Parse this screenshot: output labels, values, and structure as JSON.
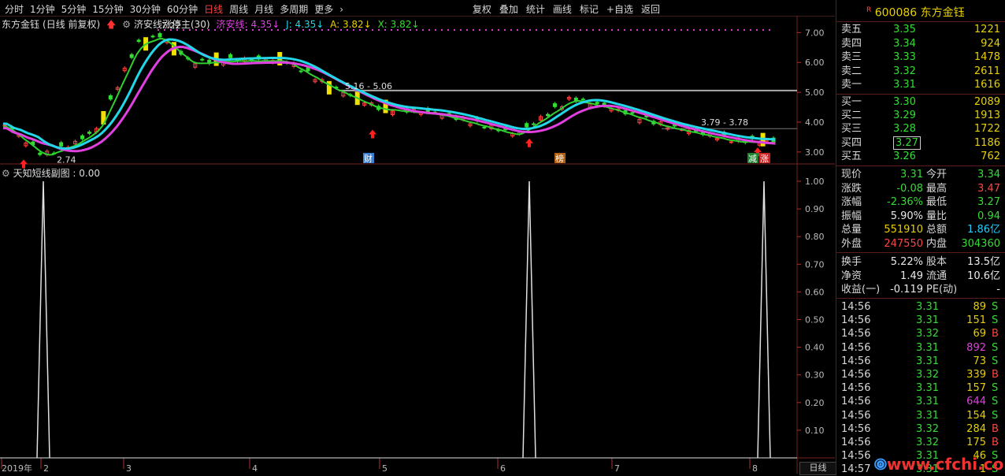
{
  "periods": [
    {
      "label": "分时"
    },
    {
      "label": "1分钟"
    },
    {
      "label": "5分钟"
    },
    {
      "label": "15分钟"
    },
    {
      "label": "30分钟"
    },
    {
      "label": "60分钟"
    },
    {
      "label": "日线",
      "active": true
    },
    {
      "label": "周线"
    },
    {
      "label": "月线"
    },
    {
      "label": "多周期"
    },
    {
      "label": "更多"
    }
  ],
  "tools": [
    "复权",
    "叠加",
    "统计",
    "画线",
    "标记",
    "+自选",
    "返回"
  ],
  "title": {
    "stock": "东方金钰",
    "mode": "(日线 前复权)",
    "indicator": "济安线涨停主(30)",
    "line_label": "济安线:",
    "line_value": "4.35↓",
    "j": "J: 4.35↓",
    "a": "A: 3.82↓",
    "x": "X: 3.82↓"
  },
  "sub_title": "天知短线副图 : 0.00",
  "annotations": {
    "high": "7.22",
    "low": "2.74",
    "band1": "5.16 - 5.06",
    "band2": "3.79 - 3.78",
    "marks": [
      {
        "text": "财",
        "color": "#3a7fd0"
      },
      {
        "text": "榜",
        "color": "#b06010"
      },
      {
        "text": "减",
        "color": "#208030"
      },
      {
        "text": "涨",
        "color": "#d02020"
      }
    ]
  },
  "price_axis": [
    "7.00",
    "6.00",
    "5.00",
    "4.00",
    "3.00"
  ],
  "sub_axis": [
    "1.00",
    "0.90",
    "0.80",
    "0.70",
    "0.60",
    "0.50",
    "0.40",
    "0.30",
    "0.20",
    "0.10"
  ],
  "x_axis": [
    "2019年",
    "2",
    "3",
    "4",
    "5",
    "6",
    "7",
    "8"
  ],
  "bottom_tab": "日线",
  "quote": {
    "code_badge": "R",
    "code": "600086",
    "name": "东方金钰",
    "asks": [
      {
        "label": "卖五",
        "price": "3.35",
        "vol": "1221"
      },
      {
        "label": "卖四",
        "price": "3.34",
        "vol": "924"
      },
      {
        "label": "卖三",
        "price": "3.33",
        "vol": "1478"
      },
      {
        "label": "卖二",
        "price": "3.32",
        "vol": "2611"
      },
      {
        "label": "卖一",
        "price": "3.31",
        "vol": "1616"
      }
    ],
    "bids": [
      {
        "label": "买一",
        "price": "3.30",
        "vol": "2089"
      },
      {
        "label": "买二",
        "price": "3.29",
        "vol": "1913"
      },
      {
        "label": "买三",
        "price": "3.28",
        "vol": "1722"
      },
      {
        "label": "买四",
        "price": "3.27",
        "vol": "1186"
      },
      {
        "label": "买五",
        "price": "3.26",
        "vol": "762"
      }
    ],
    "stats": [
      {
        "l1": "现价",
        "v1": "3.31",
        "c1": "green",
        "l2": "今开",
        "v2": "3.34",
        "c2": "green"
      },
      {
        "l1": "涨跌",
        "v1": "-0.08",
        "c1": "green",
        "l2": "最高",
        "v2": "3.47",
        "c2": "red"
      },
      {
        "l1": "涨幅",
        "v1": "-2.36%",
        "c1": "green",
        "l2": "最低",
        "v2": "3.27",
        "c2": "green"
      },
      {
        "l1": "振幅",
        "v1": "5.90%",
        "c1": "white",
        "l2": "量比",
        "v2": "0.94",
        "c2": "green"
      },
      {
        "l1": "总量",
        "v1": "551910",
        "c1": "yellow",
        "l2": "总额",
        "v2": "1.86亿",
        "c2": "cyan"
      },
      {
        "l1": "外盘",
        "v1": "247550",
        "c1": "red",
        "l2": "内盘",
        "v2": "304360",
        "c2": "green"
      }
    ],
    "stats2": [
      {
        "l1": "换手",
        "v1": "5.22%",
        "c1": "white",
        "l2": "股本",
        "v2": "13.5亿",
        "c2": "white"
      },
      {
        "l1": "净资",
        "v1": "1.49",
        "c1": "white",
        "l2": "流通",
        "v2": "10.6亿",
        "c2": "white"
      },
      {
        "l1": "收益(一)",
        "v1": "-0.119",
        "c1": "white",
        "l2": "PE(动)",
        "v2": "-",
        "c2": "white"
      }
    ],
    "ticks": [
      {
        "t": "14:56",
        "p": "3.31",
        "pc": "green",
        "v": "89",
        "vc": "yellow",
        "s": "S"
      },
      {
        "t": "14:56",
        "p": "3.31",
        "pc": "green",
        "v": "151",
        "vc": "yellow",
        "s": "S"
      },
      {
        "t": "14:56",
        "p": "3.32",
        "pc": "green",
        "v": "69",
        "vc": "yellow",
        "s": "B"
      },
      {
        "t": "14:56",
        "p": "3.31",
        "pc": "green",
        "v": "892",
        "vc": "magenta",
        "s": "S"
      },
      {
        "t": "14:56",
        "p": "3.31",
        "pc": "green",
        "v": "73",
        "vc": "yellow",
        "s": "S"
      },
      {
        "t": "14:56",
        "p": "3.32",
        "pc": "green",
        "v": "339",
        "vc": "yellow",
        "s": "B"
      },
      {
        "t": "14:56",
        "p": "3.31",
        "pc": "green",
        "v": "157",
        "vc": "yellow",
        "s": "S"
      },
      {
        "t": "14:56",
        "p": "3.31",
        "pc": "green",
        "v": "644",
        "vc": "magenta",
        "s": "S"
      },
      {
        "t": "14:56",
        "p": "3.31",
        "pc": "green",
        "v": "154",
        "vc": "yellow",
        "s": "S"
      },
      {
        "t": "14:56",
        "p": "3.32",
        "pc": "green",
        "v": "284",
        "vc": "yellow",
        "s": "B"
      },
      {
        "t": "14:56",
        "p": "3.32",
        "pc": "green",
        "v": "175",
        "vc": "yellow",
        "s": "B"
      },
      {
        "t": "14:56",
        "p": "3.31",
        "pc": "green",
        "v": "46",
        "vc": "yellow",
        "s": "S"
      },
      {
        "t": "14:57",
        "p": "3.31",
        "pc": "green",
        "v": "1",
        "vc": "yellow",
        "s": "S"
      }
    ]
  },
  "watermark": "www.cfchi.com",
  "colors": {
    "up": "#ff4444",
    "down": "#33dd33",
    "cyan_line": "#22d8e8",
    "magenta_line": "#e040e0",
    "candle_yellow": "#f0e000",
    "spike": "#e0e0e0"
  }
}
